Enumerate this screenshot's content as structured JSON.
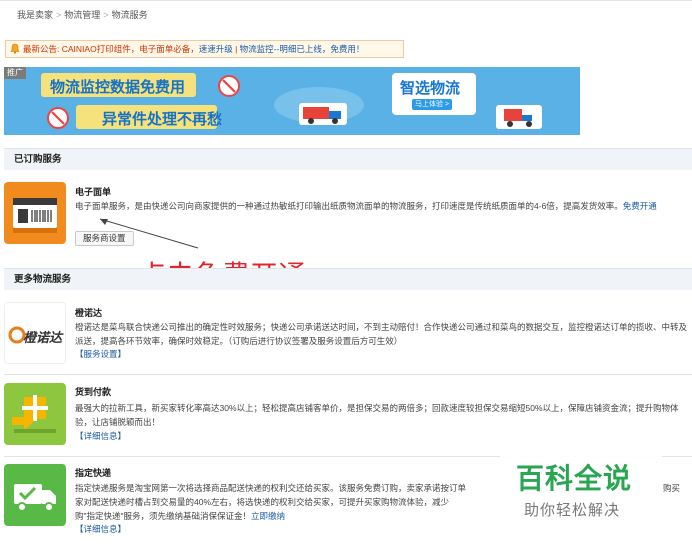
{
  "breadcrumb": {
    "items": [
      "我是卖家",
      "物流管理",
      "物流服务"
    ],
    "separator": ">"
  },
  "notice": {
    "prefix": "最新公告:",
    "text1": "CAINIAO打印组件，电子面单必备，",
    "link1": "速速升级",
    "sep": " | ",
    "text2": "物流监控--明细已上线，免费用！"
  },
  "banner": {
    "tag": "推广",
    "line1": "物流监控数据免费用",
    "line2": "异常件处理不再愁",
    "brand": "智选物流",
    "cta": "马上体验 >"
  },
  "subscribed_section": {
    "title": "已订购服务"
  },
  "subscribed": [
    {
      "title": "电子面单",
      "desc": "电子面单服务，是由快递公司向商家提供的一种通过热敏纸打印输出纸质物流面单的物流服务，打印速度是传统纸质面单的4-6倍，提高发货效率。",
      "link": "免费开通",
      "button": "服务商设置"
    }
  ],
  "annotation": "点击免费开通",
  "more_section": {
    "title": "更多物流服务"
  },
  "more": [
    {
      "title": "橙诺达",
      "logo": "橙诺达",
      "desc": "橙诺达是菜鸟联合快递公司推出的确定性时效服务；快递公司承诺送达时间，不到主动赔付！合作快递公司通过和菜鸟的数据交互，监控橙诺达订单的揽收、中转及派送，提高各环节效率，确保时效稳定。（订购后进行协议签署及服务设置后方可生效）",
      "link": "【服务设置】"
    },
    {
      "title": "货到付款",
      "desc": "最强大的拉新工具，新买家转化率高达30%以上；轻松提高店铺客单价，是担保交易的两倍多；回款速度较担保交易缩短50%以上，保障店铺资金流；提升购物体验，让店铺脱颖而出！",
      "link": "【详细信息】"
    },
    {
      "title": "指定快递",
      "desc_a": "指定快递服务是淘宝网第一次将选择商品配送快递的权利交还给买家。该服务免费订购，卖家承诺按订单",
      "desc_b": "购买",
      "desc_c": "家对配送快递时槽占到交易量的40%左右，将选快递的权利交给买家，可提升买家购物流体验，减少",
      "desc_d": "购\"指定快递\"服务，须先缴纳基础消保保证金！",
      "link_inline": "立即缴纳",
      "link": "【详细信息】"
    }
  ],
  "watermark": {
    "big": "百科全说",
    "small": "助你轻松解决"
  },
  "colors": {
    "link": "#1a5aa6",
    "annotation": "#e0262c",
    "banner_bg": "#5ab1e6"
  }
}
